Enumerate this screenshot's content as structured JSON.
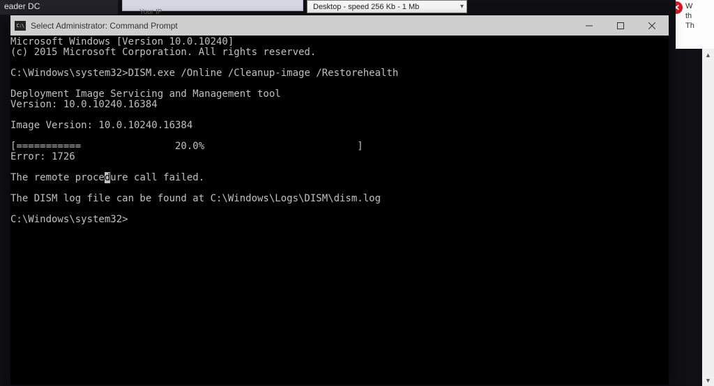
{
  "taskbar_fragment": "eader DC",
  "bg_label": "Your IP",
  "speed_dropdown": {
    "selected": "Desktop - speed  256 Kb - 1 Mb"
  },
  "right_strip": {
    "l1": "W",
    "l2": "th",
    "l3": "Th"
  },
  "cmd": {
    "title": "Select Administrator: Command Prompt",
    "icon_text": "C:\\",
    "out": {
      "l1": "Microsoft Windows [Version 10.0.10240]",
      "l2": "(c) 2015 Microsoft Corporation. All rights reserved.",
      "l3": "",
      "p1a": "C:\\Windows\\system32>",
      "p1b": "DISM.exe /Online /Cleanup-image /Restorehealth",
      "l5": "",
      "l6": "Deployment Image Servicing and Management tool",
      "l7": "Version: 10.0.10240.16384",
      "l8": "",
      "l9": "Image Version: 10.0.10240.16384",
      "l10": "",
      "l11": "[===========                20.0%                          ]",
      "l12": "Error: 1726",
      "l13": "",
      "err_a": "The remote proce",
      "err_cur": "d",
      "err_b": "ure call failed.",
      "l15": "",
      "l16": "The DISM log file can be found at C:\\Windows\\Logs\\DISM\\dism.log",
      "l17": "",
      "p2": "C:\\Windows\\system32>"
    }
  }
}
